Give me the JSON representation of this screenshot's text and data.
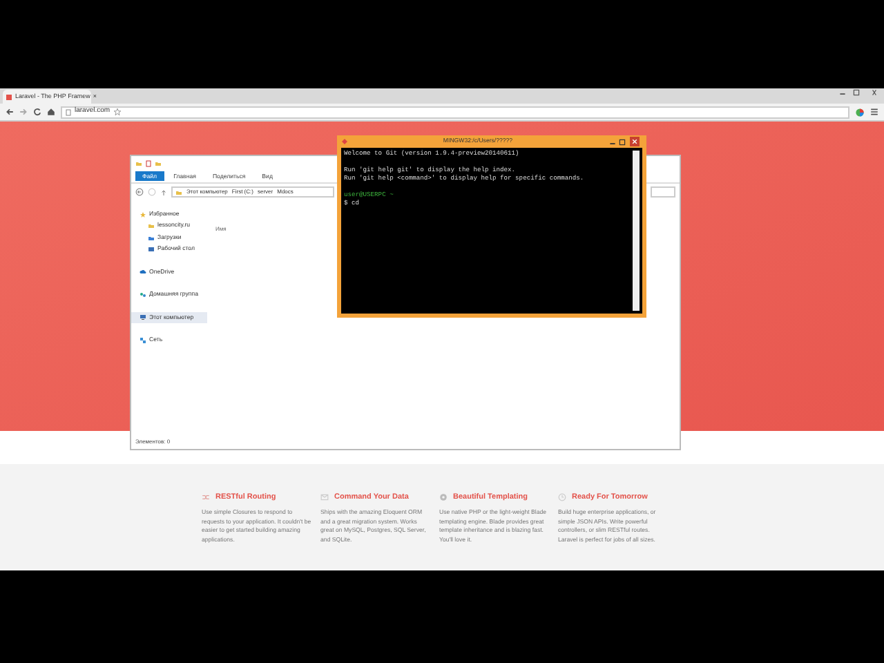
{
  "browser": {
    "tab_title": "Laravel - The PHP Framew",
    "tab_close": "×",
    "url": "laravel.com"
  },
  "explorer": {
    "ribbon_tabs": [
      {
        "label": "Файл",
        "selected": true
      },
      {
        "label": "Главная",
        "selected": false
      },
      {
        "label": "Поделиться",
        "selected": false
      },
      {
        "label": "Вид",
        "selected": false
      }
    ],
    "breadcrumb": [
      "Этот компьютер",
      "First (C:)",
      "server",
      "Mdocs"
    ],
    "column_header": "Имя",
    "sidebar": [
      {
        "label": "Избранное",
        "kind": "favorites",
        "selected": false,
        "children": [
          {
            "label": "lessoncity.ru",
            "kind": "folder",
            "selected": false
          },
          {
            "label": "Загрузки",
            "kind": "downloads",
            "selected": false
          },
          {
            "label": "Рабочий стол",
            "kind": "desktop",
            "selected": false
          }
        ]
      },
      {
        "label": "OneDrive",
        "kind": "cloud",
        "selected": false
      },
      {
        "label": "Домашняя группа",
        "kind": "homegroup",
        "selected": false
      },
      {
        "label": "Этот компьютер",
        "kind": "computer",
        "selected": true
      },
      {
        "label": "Сеть",
        "kind": "network",
        "selected": false
      }
    ],
    "status": "Элементов: 0"
  },
  "terminal": {
    "title": "MINGW32:/c/Users/?????",
    "lines": [
      {
        "text": "Welcome to Git (version 1.9.4-preview20140611)",
        "kind": "output"
      },
      {
        "text": "Run 'git help git' to display the help index.",
        "kind": "output"
      },
      {
        "text": "Run 'git help <command>' to display help for specific commands.",
        "kind": "output"
      },
      {
        "text": "user@USERPC ~",
        "kind": "prompt"
      },
      {
        "text": "$ cd",
        "kind": "output"
      }
    ]
  },
  "features": [
    {
      "title": "RESTful Routing",
      "text": "Use simple Closures to respond to requests to your application. It couldn't be easier to get started building amazing applications."
    },
    {
      "title": "Command Your Data",
      "text": "Ships with the amazing Eloquent ORM and a great migration system. Works great on MySQL, Postgres, SQL Server, and SQLite."
    },
    {
      "title": "Beautiful Templating",
      "text": "Use native PHP or the light-weight Blade templating engine. Blade provides great template inheritance and is blazing fast. You'll love it."
    },
    {
      "title": "Ready For Tomorrow",
      "text": "Build huge enterprise applications, or simple JSON APIs. Write powerful controllers, or slim RESTful routes. Laravel is perfect for jobs of all sizes."
    }
  ]
}
